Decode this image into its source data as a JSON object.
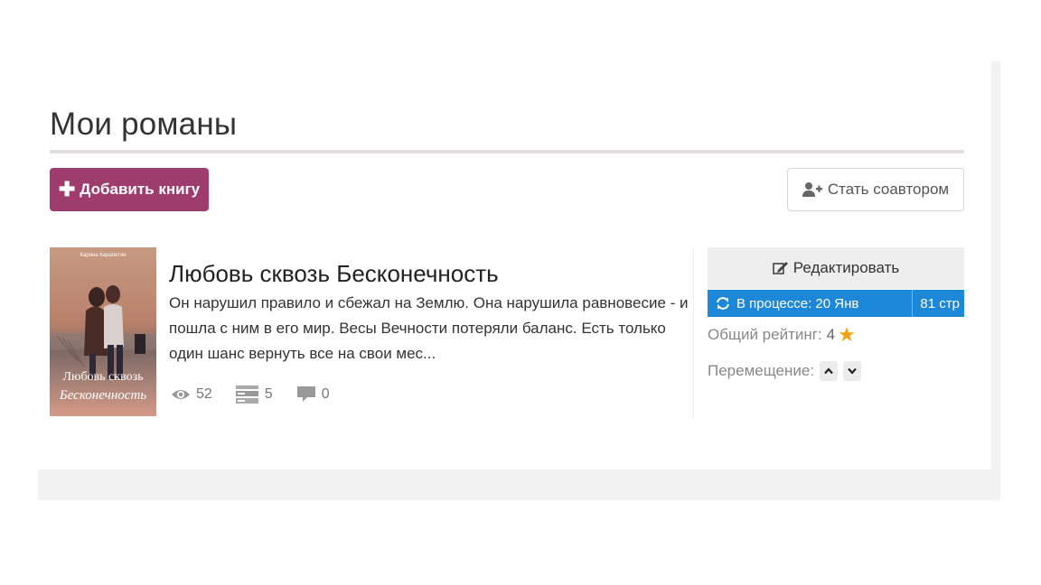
{
  "page": {
    "title": "Мои романы"
  },
  "toolbar": {
    "add_book_label": "Добавить книгу",
    "coauthor_label": "Стать соавтором"
  },
  "book": {
    "cover": {
      "author_text": "Карина Карапетян",
      "title_line1": "Любовь сквозь",
      "title_line2": "Бесконечность"
    },
    "title": "Любовь сквозь Бесконечность",
    "description": "Он нарушил правило и сбежал на Землю. Она нарушила равновесие - и пошла с ним в его мир. Весы Вечности потеряли баланс. Есть только один шанс вернуть все на свои мес...",
    "stats": {
      "views": "52",
      "chapters": "5",
      "comments": "0"
    },
    "edit_label": "Редактировать",
    "status": {
      "text": "В процессе: 20 Янв",
      "pages": "81 стр"
    },
    "rating": {
      "label": "Общий рейтинг:",
      "value": "4"
    },
    "move_label": "Перемещение:"
  },
  "colors": {
    "accent": "#9e3d6d",
    "status_blue": "#1e88d8",
    "star": "#f0a30a"
  },
  "icons": {
    "add": "plus-icon",
    "coauthor": "user-plus-icon",
    "views": "eye-icon",
    "chapters": "chapters-icon",
    "comments": "comment-icon",
    "edit": "edit-icon",
    "status": "refresh-icon",
    "rating": "star-icon",
    "up": "chevron-up-icon",
    "down": "chevron-down-icon"
  }
}
